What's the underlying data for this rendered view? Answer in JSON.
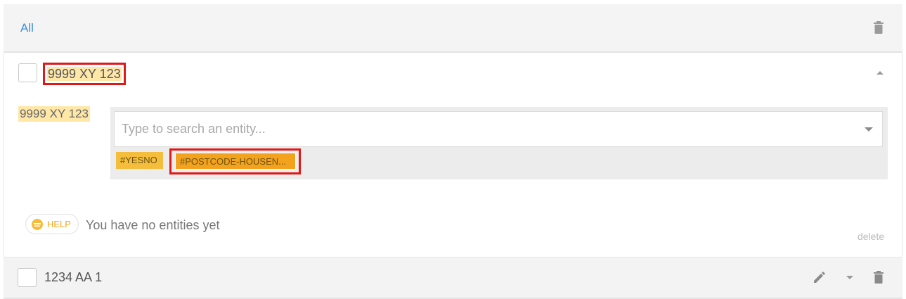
{
  "header": {
    "filter_label": "All"
  },
  "example": {
    "text": "9999 XY 123",
    "entity_label": "9999 XY 123",
    "search": {
      "placeholder": "Type to search an entity...",
      "value": ""
    },
    "tags": [
      "#YESNO",
      "#POSTCODE-HOUSEN..."
    ],
    "help_label": "HELP",
    "no_entities_text": "You have no entities yet",
    "delete_label": "delete"
  },
  "row2": {
    "text": "1234 AA 1"
  },
  "colors": {
    "accent_link": "#3a8fd6",
    "highlight": "#ffe7a8",
    "tag_yesno": "#f5bd3c",
    "tag_postcode": "#f3a21e",
    "annotation_box": "#e01818"
  }
}
